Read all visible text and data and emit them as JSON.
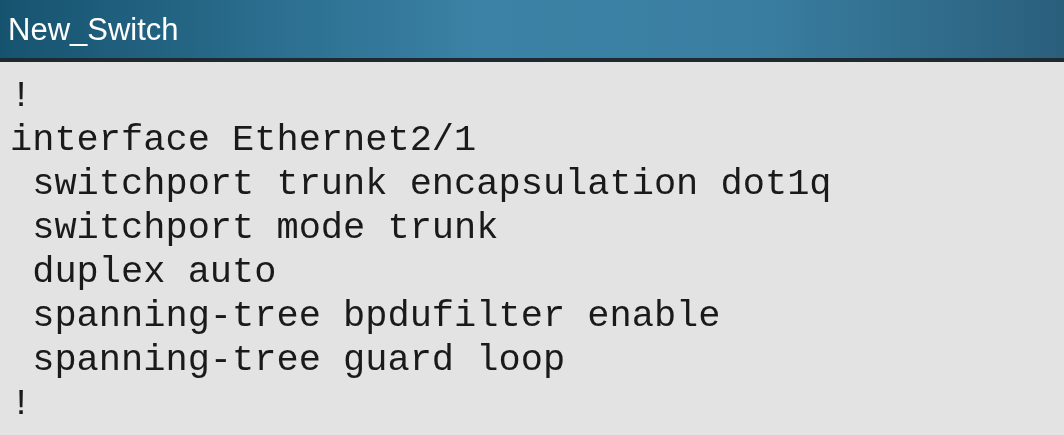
{
  "window": {
    "title": "New_Switch"
  },
  "console": {
    "lines": [
      "!",
      "interface Ethernet2/1",
      " switchport trunk encapsulation dot1q",
      " switchport mode trunk",
      " duplex auto",
      " spanning-tree bpdufilter enable",
      " spanning-tree guard loop",
      "!"
    ]
  }
}
